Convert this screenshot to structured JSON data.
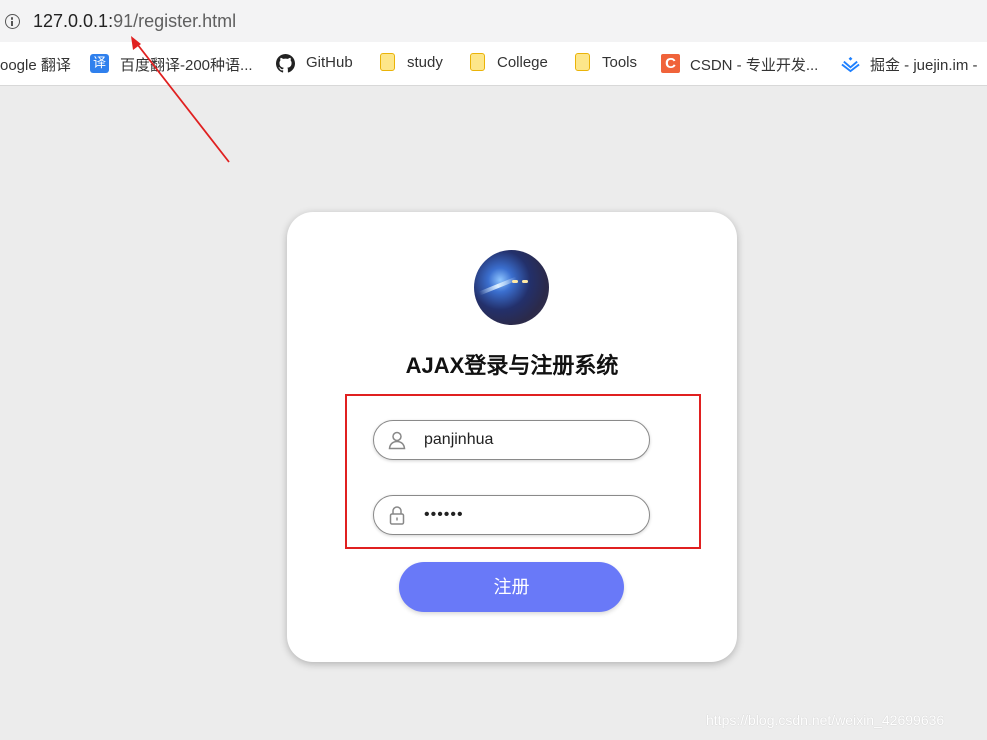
{
  "browser": {
    "url_host": "127.0.0.1:",
    "url_rest": "91/register.html"
  },
  "bookmarks": [
    {
      "label": "oogle 翻译",
      "icon": "google-translate-icon"
    },
    {
      "label": "百度翻译-200种语...",
      "icon": "baidu-translate-icon",
      "icon_glyph": "译"
    },
    {
      "label": "GitHub",
      "icon": "github-icon"
    },
    {
      "label": "study",
      "icon": "folder-icon"
    },
    {
      "label": "College",
      "icon": "folder-icon"
    },
    {
      "label": "Tools",
      "icon": "folder-icon"
    },
    {
      "label": "CSDN - 专业开发...",
      "icon": "csdn-icon",
      "icon_glyph": "C"
    },
    {
      "label": "掘金 - juejin.im -",
      "icon": "juejin-icon"
    }
  ],
  "card": {
    "title": "AJAX登录与注册系统",
    "username": "panjinhua",
    "password": "••••••",
    "submit_label": "注册"
  },
  "watermark": "https://blog.csdn.net/weixin_42699636",
  "colors": {
    "accent": "#6979f8",
    "annotation": "#e02020",
    "background": "#ececec"
  }
}
